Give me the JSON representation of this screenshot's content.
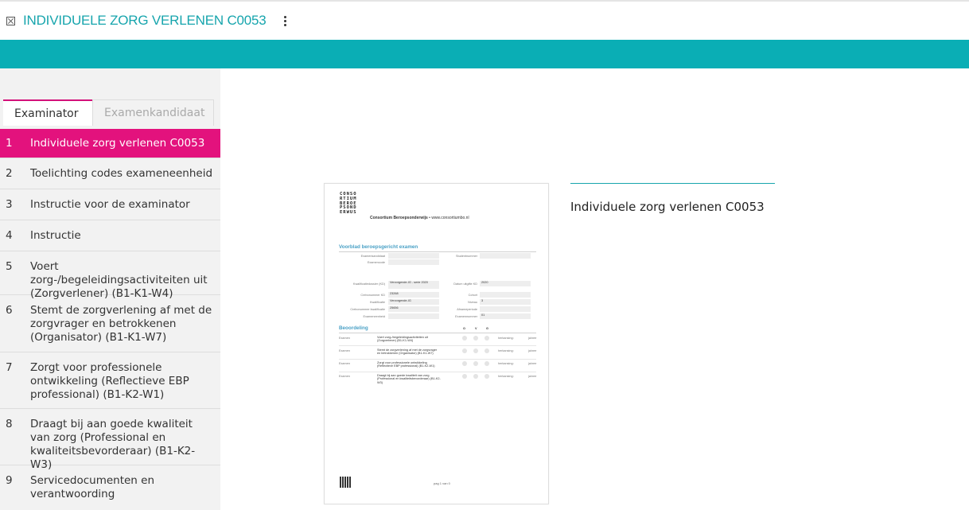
{
  "app": {
    "title": "INDIVIDUELE ZORG VERLENEN C0053",
    "accent": "#0aaeb5",
    "highlight": "#e3127d"
  },
  "tabs": [
    {
      "label": "Examinator"
    },
    {
      "label": "Examenkandidaat"
    }
  ],
  "nav": [
    {
      "num": "1",
      "label": "Individuele zorg verlenen C0053"
    },
    {
      "num": "2",
      "label": "Toelichting codes exameneenheid"
    },
    {
      "num": "3",
      "label": "Instructie voor de examinator"
    },
    {
      "num": "4",
      "label": "Instructie"
    },
    {
      "num": "5",
      "label": "Voert zorg-/begeleidingsactiviteiten uit (Zorgverlener) (B1-K1-W4)"
    },
    {
      "num": "6",
      "label": "Stemt de zorgverlening af met de zorgvrager en betrokkenen (Organisator) (B1-K1-W7)"
    },
    {
      "num": "7",
      "label": "Zorgt voor professionele ontwikkeling (Reflectieve EBP professional) (B1-K2-W1)"
    },
    {
      "num": "8",
      "label": "Draagt bij aan goede kwaliteit van zorg (Professional en kwaliteitsbevorderaar) (B1-K2-W3)"
    },
    {
      "num": "9",
      "label": "Servicedocumenten en verantwoording"
    }
  ],
  "document": {
    "logo_rows": [
      "CONSO",
      "RTIUM",
      "BEROE",
      "PSOND",
      "ERWUS"
    ],
    "org_name": "Consortium Beroepsonderwijs",
    "org_url": " • www.consortiumbo.nl",
    "section1": "Voorblad beroepsgericht examen",
    "fields_top": {
      "examenkandidaat": "Examenkandidaat",
      "examencode": "Examencode",
      "studentnummer": "Studentnummer"
    },
    "fields_mid": {
      "kd_label": "Kwalificatiedossier (KD)",
      "kd_value": "Verzorgende-IG - serie 2020",
      "crebo_kd_label": "Crebonummer KD",
      "crebo_kd_value": "23268",
      "kwal_label": "Kwalificatie",
      "kwal_value": "Verzorgende-IG",
      "crebo_kwal_label": "Crebonummer kwalificatie",
      "crebo_kwal_value": "25656",
      "exameneenheid_label": "Exameneenheid",
      "datum_label": "Datum uitgifte KD",
      "datum_value": "2020",
      "cohort_label": "Cohort",
      "niveau_label": "Niveau",
      "niveau_value": "3",
      "afname_label": "Afnameperiode",
      "examennummer_label": "Examennummer",
      "examennummer_value": "01"
    },
    "section2": "Beoordeling",
    "ovg": [
      "O",
      "V",
      "G"
    ],
    "rows": [
      {
        "label": "Examen",
        "text": "Voert zorg-/begeleidingsactiviteiten uit (Zorgverlener) (B1-K1-W4)",
        "herk": "herkansing:",
        "ja": "ja/nee"
      },
      {
        "label": "Examen",
        "text": "Stemt de zorgverlening af met de zorgvrager en betrokkenen (Organisator) (B1-K1-W7)",
        "herk": "herkansing:",
        "ja": "ja/nee"
      },
      {
        "label": "Examen",
        "text": "Zorgt voor professionele ontwikkeling (Reflectieve EBP professional) (B1-K2-W1)",
        "herk": "herkansing:",
        "ja": "ja/nee"
      },
      {
        "label": "Examen",
        "text": "Draagt bij aan goede kwaliteit van zorg (Professional en kwaliteitsbevorderaar) (B1-K2-W3)",
        "herk": "herkansing:",
        "ja": "ja/nee"
      }
    ],
    "page": "pag 1 van 0"
  },
  "detail": {
    "title": "Individuele zorg verlenen C0053"
  }
}
